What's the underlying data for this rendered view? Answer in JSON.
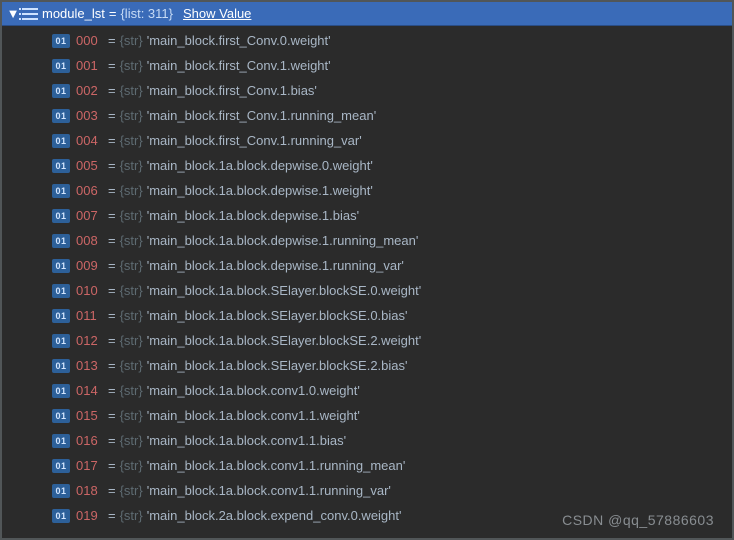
{
  "header": {
    "variable_name": "module_lst",
    "eq": "=",
    "type_label": "{list: 311}",
    "show_value_label": "Show Value"
  },
  "badge_text": "01",
  "eq_symbol": "=",
  "item_type_label": "{str}",
  "items": [
    {
      "index": "000",
      "value": "'main_block.first_Conv.0.weight'"
    },
    {
      "index": "001",
      "value": "'main_block.first_Conv.1.weight'"
    },
    {
      "index": "002",
      "value": "'main_block.first_Conv.1.bias'"
    },
    {
      "index": "003",
      "value": "'main_block.first_Conv.1.running_mean'"
    },
    {
      "index": "004",
      "value": "'main_block.first_Conv.1.running_var'"
    },
    {
      "index": "005",
      "value": "'main_block.1a.block.depwise.0.weight'"
    },
    {
      "index": "006",
      "value": "'main_block.1a.block.depwise.1.weight'"
    },
    {
      "index": "007",
      "value": "'main_block.1a.block.depwise.1.bias'"
    },
    {
      "index": "008",
      "value": "'main_block.1a.block.depwise.1.running_mean'"
    },
    {
      "index": "009",
      "value": "'main_block.1a.block.depwise.1.running_var'"
    },
    {
      "index": "010",
      "value": "'main_block.1a.block.SElayer.blockSE.0.weight'"
    },
    {
      "index": "011",
      "value": "'main_block.1a.block.SElayer.blockSE.0.bias'"
    },
    {
      "index": "012",
      "value": "'main_block.1a.block.SElayer.blockSE.2.weight'"
    },
    {
      "index": "013",
      "value": "'main_block.1a.block.SElayer.blockSE.2.bias'"
    },
    {
      "index": "014",
      "value": "'main_block.1a.block.conv1.0.weight'"
    },
    {
      "index": "015",
      "value": "'main_block.1a.block.conv1.1.weight'"
    },
    {
      "index": "016",
      "value": "'main_block.1a.block.conv1.1.bias'"
    },
    {
      "index": "017",
      "value": "'main_block.1a.block.conv1.1.running_mean'"
    },
    {
      "index": "018",
      "value": "'main_block.1a.block.conv1.1.running_var'"
    },
    {
      "index": "019",
      "value": "'main_block.2a.block.expend_conv.0.weight'"
    }
  ],
  "watermark": "CSDN @qq_57886603"
}
